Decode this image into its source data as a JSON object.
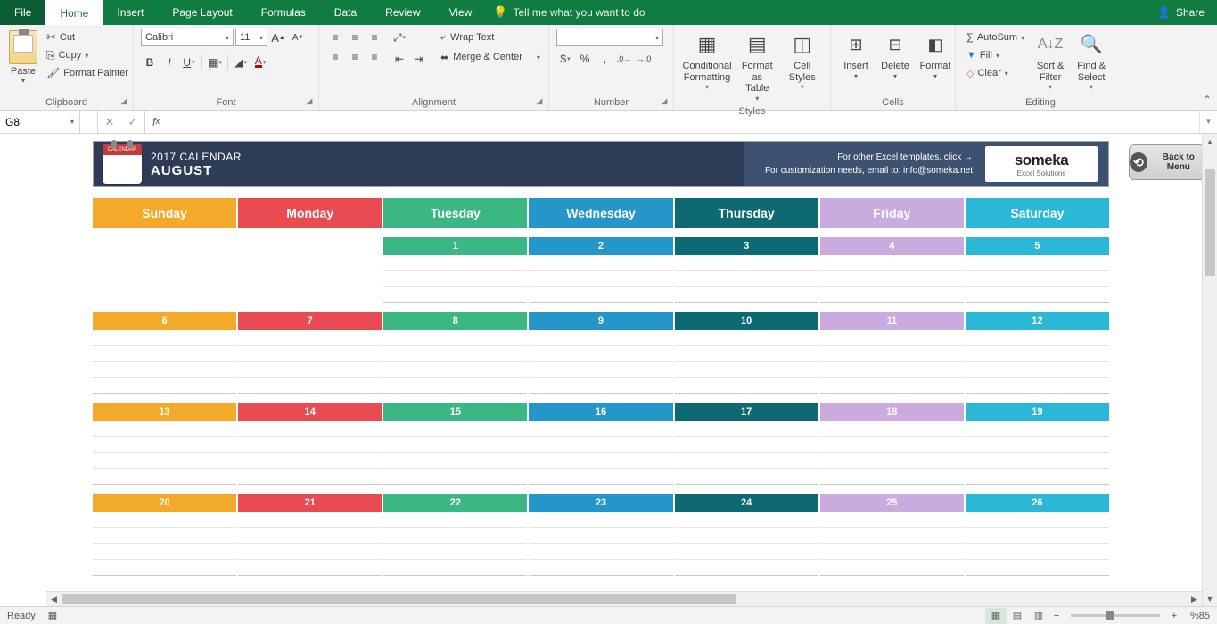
{
  "menu": {
    "tabs": [
      "File",
      "Home",
      "Insert",
      "Page Layout",
      "Formulas",
      "Data",
      "Review",
      "View"
    ],
    "active": "Home",
    "tell_me": "Tell me what you want to do",
    "share": "Share"
  },
  "ribbon": {
    "clipboard": {
      "title": "Clipboard",
      "paste": "Paste",
      "cut": "Cut",
      "copy": "Copy",
      "format_painter": "Format Painter"
    },
    "font": {
      "title": "Font",
      "family": "Calibri",
      "size": "11"
    },
    "alignment": {
      "title": "Alignment",
      "wrap": "Wrap Text",
      "merge": "Merge & Center"
    },
    "number": {
      "title": "Number",
      "format": ""
    },
    "styles": {
      "title": "Styles",
      "cond": "Conditional Formatting",
      "table": "Format as Table",
      "cell": "Cell Styles"
    },
    "cells": {
      "title": "Cells",
      "insert": "Insert",
      "delete": "Delete",
      "format": "Format"
    },
    "editing": {
      "title": "Editing",
      "autosum": "AutoSum",
      "fill": "Fill",
      "clear": "Clear",
      "sort": "Sort & Filter",
      "find": "Find & Select"
    }
  },
  "formula_bar": {
    "cell": "G8",
    "value": ""
  },
  "calendar": {
    "title": "2017 CALENDAR",
    "month": "AUGUST",
    "note1": "For other Excel templates, click →",
    "note2": "For customization needs, email to: info@someka.net",
    "logo": "someka",
    "logo_sub": "Excel Solutions",
    "back": "Back to Menu",
    "days": [
      "Sunday",
      "Monday",
      "Tuesday",
      "Wednesday",
      "Thursday",
      "Friday",
      "Saturday"
    ],
    "day_classes": [
      "sun",
      "mon",
      "tue",
      "wed",
      "thu",
      "fri",
      "sat"
    ],
    "weeks": [
      [
        null,
        null,
        1,
        2,
        3,
        4,
        5
      ],
      [
        6,
        7,
        8,
        9,
        10,
        11,
        12
      ],
      [
        13,
        14,
        15,
        16,
        17,
        18,
        19
      ],
      [
        20,
        21,
        22,
        23,
        24,
        25,
        26
      ]
    ]
  },
  "status": {
    "ready": "Ready",
    "zoom": "%85"
  }
}
